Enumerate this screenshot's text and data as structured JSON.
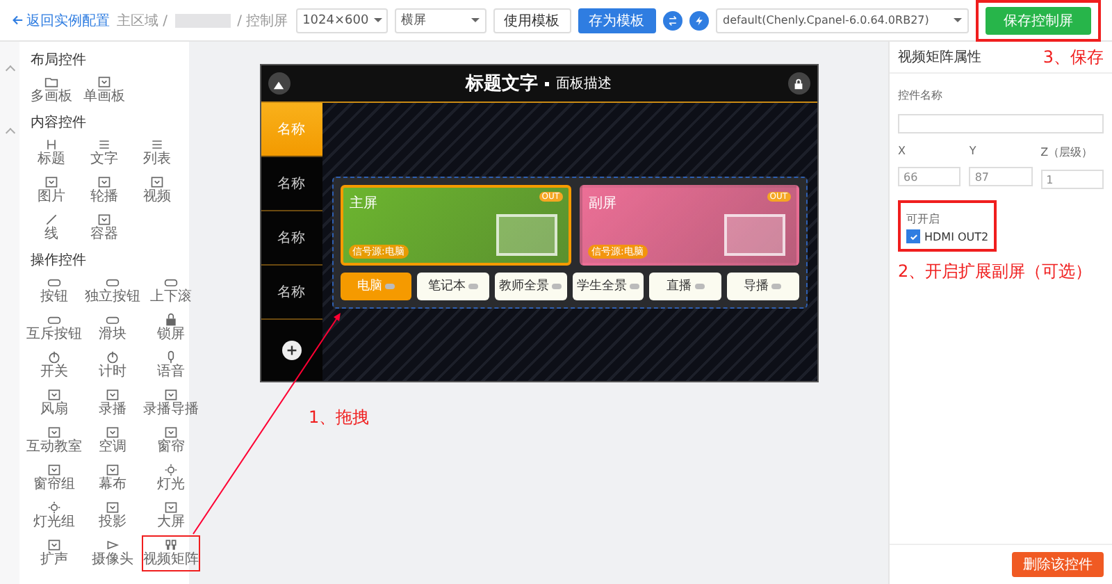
{
  "top_bar": {
    "back_link": "返回实例配置",
    "breadcrumb": [
      "主区域 /",
      "/ 控制屏"
    ],
    "resolution": "1024×600",
    "orientation": "横屏",
    "buttons": [
      "使用模板",
      "存为模板"
    ],
    "theme": "default(Chenly.Cpanel-6.0.64.0RB27)",
    "save_button": {
      "label": "保存控制屏",
      "highlighted": true
    }
  },
  "palette": [
    {
      "title": "布局控件",
      "items": [
        {
          "label": "多画板",
          "highlighted": false
        },
        {
          "label": "单画板",
          "highlighted": false
        }
      ]
    },
    {
      "title": "内容控件",
      "items": [
        {
          "label": "标题",
          "highlighted": false
        },
        {
          "label": "文字",
          "highlighted": false
        },
        {
          "label": "列表",
          "highlighted": false
        },
        {
          "label": "图片",
          "highlighted": false
        },
        {
          "label": "轮播",
          "highlighted": false
        },
        {
          "label": "视频",
          "highlighted": false
        },
        {
          "label": "线",
          "highlighted": false
        },
        {
          "label": "容器",
          "highlighted": false
        }
      ]
    },
    {
      "title": "操作控件",
      "items": [
        {
          "label": "按钮",
          "highlighted": false
        },
        {
          "label": "独立按钮",
          "highlighted": false
        },
        {
          "label": "上下滚",
          "highlighted": false
        },
        {
          "label": "互斥按钮",
          "highlighted": false
        },
        {
          "label": "滑块",
          "highlighted": false
        },
        {
          "label": "锁屏",
          "highlighted": false
        },
        {
          "label": "开关",
          "highlighted": false
        },
        {
          "label": "计时",
          "highlighted": false
        },
        {
          "label": "语音",
          "highlighted": false
        },
        {
          "label": "风扇",
          "highlighted": false
        },
        {
          "label": "录播",
          "highlighted": false
        },
        {
          "label": "录播导播",
          "highlighted": false
        },
        {
          "label": "互动教室",
          "highlighted": false
        },
        {
          "label": "空调",
          "highlighted": false
        },
        {
          "label": "窗帘",
          "highlighted": false
        },
        {
          "label": "窗帘组",
          "highlighted": false
        },
        {
          "label": "幕布",
          "highlighted": false
        },
        {
          "label": "灯光",
          "highlighted": false
        },
        {
          "label": "灯光组",
          "highlighted": false
        },
        {
          "label": "投影",
          "highlighted": false
        },
        {
          "label": "大屏",
          "highlighted": false
        },
        {
          "label": "扩声",
          "highlighted": false
        },
        {
          "label": "摄像头",
          "highlighted": false
        },
        {
          "label": "视频矩阵",
          "highlighted": true
        }
      ]
    }
  ],
  "canvas": {
    "title": "标题文字",
    "subtitle": "面板描述",
    "nav": [
      {
        "label": "名称",
        "selected": true
      },
      {
        "label": "名称",
        "selected": false
      },
      {
        "label": "名称",
        "selected": false
      },
      {
        "label": "名称",
        "selected": false
      }
    ],
    "widget": {
      "outputs": [
        {
          "name": "主屏",
          "badge": "OUT",
          "source": "信号源:电脑",
          "selected": true,
          "color": "#6cb52f"
        },
        {
          "name": "副屏",
          "badge": "OUT",
          "source": "信号源:电脑",
          "selected": false,
          "color": "#ec6f96"
        }
      ],
      "inputs": [
        {
          "label": "电脑",
          "selected": true
        },
        {
          "label": "笔记本",
          "selected": false
        },
        {
          "label": "教师全景",
          "selected": false
        },
        {
          "label": "学生全景",
          "selected": false
        },
        {
          "label": "直播",
          "selected": false
        },
        {
          "label": "导播",
          "selected": false
        }
      ]
    }
  },
  "properties": {
    "title": "视频矩阵属性",
    "name_label": "控件名称",
    "coords": [
      {
        "label": "X",
        "value": "66"
      },
      {
        "label": "Y",
        "value": "87"
      },
      {
        "label": "Z（层级）",
        "value": "1"
      }
    ],
    "enable_group": {
      "label": "可开启",
      "highlighted": true,
      "options": [
        {
          "label": "HDMI OUT2",
          "checked": true
        }
      ]
    },
    "delete_button": "删除该控件"
  },
  "annotations": [
    "3、保存",
    "2、开启扩展副屏（可选）",
    "1、拖拽"
  ]
}
